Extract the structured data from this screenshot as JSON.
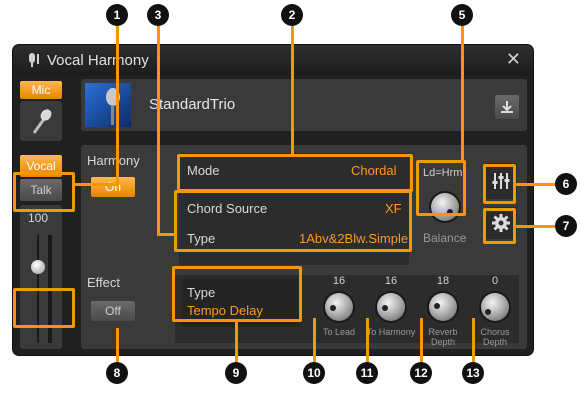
{
  "window": {
    "title": "Vocal Harmony",
    "close_icon": "close-icon"
  },
  "mic_button": "Mic",
  "preset": {
    "name": "StandardTrio"
  },
  "vocal_tab": "Vocal",
  "talk_tab": "Talk",
  "mic_level": "100",
  "harmony": {
    "label": "Harmony",
    "toggle": "On",
    "mode_label": "Mode",
    "mode_value": "Chordal",
    "chord_source_label": "Chord Source",
    "chord_source_value": "XF",
    "type_label": "Type",
    "type_value": "1Abv&2Blw.Simple",
    "balance_top": "Ld=Hrm",
    "balance_label": "Balance"
  },
  "effect": {
    "label": "Effect",
    "toggle": "Off",
    "type_label": "Type",
    "type_value": "Tempo Delay",
    "knobs": [
      {
        "value": "16",
        "label": "To Lead"
      },
      {
        "value": "16",
        "label": "To Harmony"
      },
      {
        "value": "18",
        "label": "Reverb Depth"
      },
      {
        "value": "0",
        "label": "Chorus Depth"
      }
    ]
  },
  "callouts": [
    "1",
    "2",
    "3",
    "5",
    "6",
    "7",
    "8",
    "9",
    "10",
    "11",
    "12",
    "13"
  ],
  "colors": {
    "accent": "#f39800",
    "panel": "#3a3a3a",
    "window": "#202020"
  }
}
